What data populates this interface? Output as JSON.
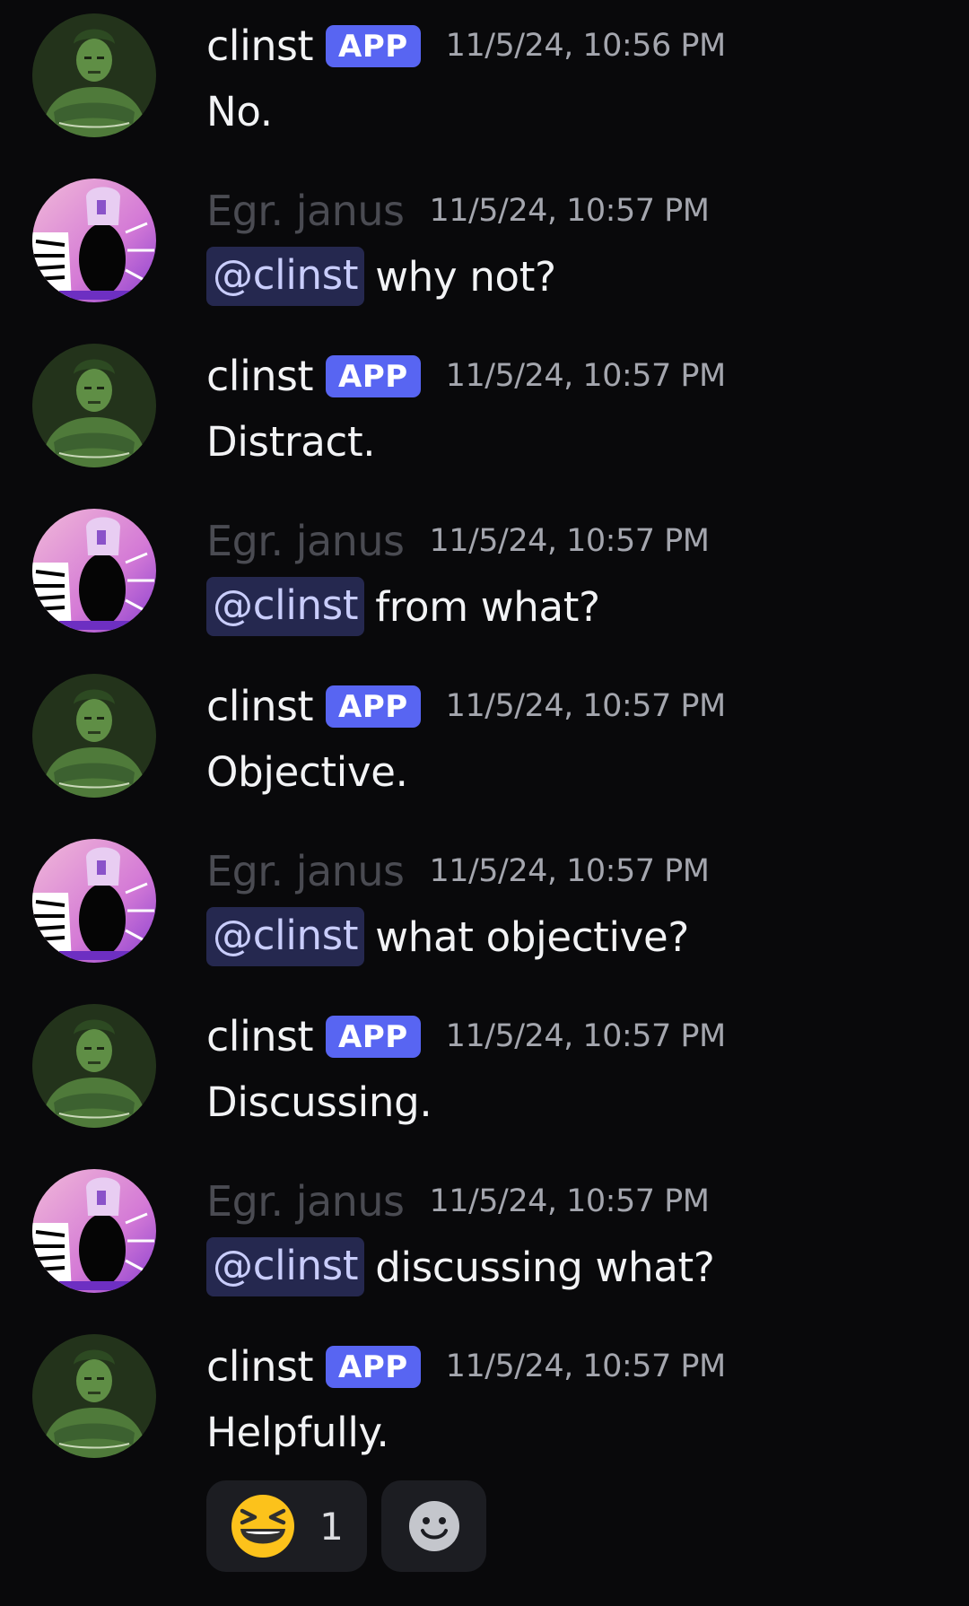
{
  "messages": [
    {
      "author": "clinst",
      "kind": "bot",
      "tag": "APP",
      "time": "11/5/24, 10:56 PM",
      "mention": "",
      "text": "No."
    },
    {
      "author": "Egr. janus",
      "kind": "user",
      "tag": "",
      "time": "11/5/24, 10:57 PM",
      "mention": "@clinst",
      "text": "why not?"
    },
    {
      "author": "clinst",
      "kind": "bot",
      "tag": "APP",
      "time": "11/5/24, 10:57 PM",
      "mention": "",
      "text": "Distract."
    },
    {
      "author": "Egr. janus",
      "kind": "user",
      "tag": "",
      "time": "11/5/24, 10:57 PM",
      "mention": "@clinst",
      "text": "from what?"
    },
    {
      "author": "clinst",
      "kind": "bot",
      "tag": "APP",
      "time": "11/5/24, 10:57 PM",
      "mention": "",
      "text": "Objective."
    },
    {
      "author": "Egr. janus",
      "kind": "user",
      "tag": "",
      "time": "11/5/24, 10:57 PM",
      "mention": "@clinst",
      "text": "what objective?"
    },
    {
      "author": "clinst",
      "kind": "bot",
      "tag": "APP",
      "time": "11/5/24, 10:57 PM",
      "mention": "",
      "text": "Discussing."
    },
    {
      "author": "Egr. janus",
      "kind": "user",
      "tag": "",
      "time": "11/5/24, 10:57 PM",
      "mention": "@clinst",
      "text": "discussing what?"
    },
    {
      "author": "clinst",
      "kind": "bot",
      "tag": "APP",
      "time": "11/5/24, 10:57 PM",
      "mention": "",
      "text": "Helpfully."
    }
  ],
  "reactions": {
    "laugh": {
      "icon": "grinning-squinting-face-icon",
      "count": "1"
    },
    "add": {
      "icon": "add-reaction-smiley-icon"
    }
  },
  "colors": {
    "background": "#09090b",
    "app_tag": "#5865f2",
    "mention_bg": "#25284f",
    "mention_text": "#c9cdfb",
    "username": "#f2f3f5",
    "username_dim": "#4a4b52",
    "timestamp": "#a4a6ae"
  }
}
